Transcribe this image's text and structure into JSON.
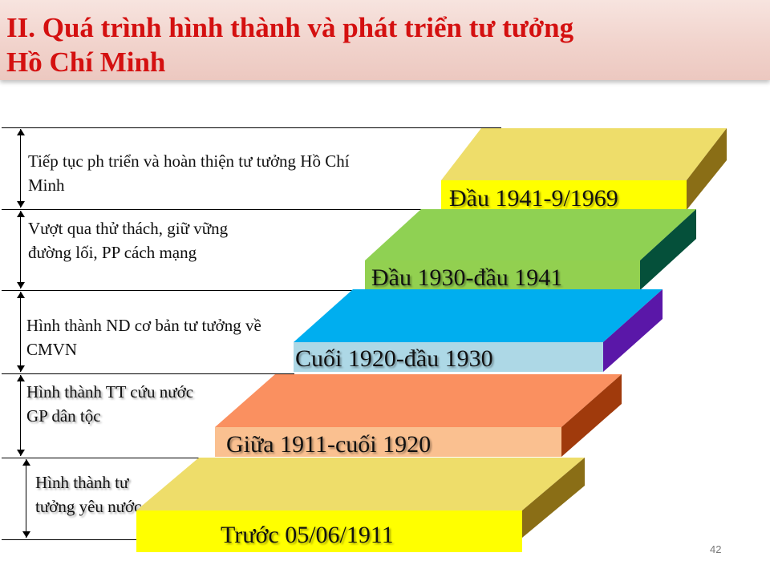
{
  "title": {
    "line1": "II. Quá trình hình thành và phát triển tư tưởng",
    "line2": "Hồ Chí Minh"
  },
  "stages": [
    {
      "period": "Đầu 1941-9/1969",
      "description": "Tiếp tục ph triển và hoàn thiện tư tưởng Hồ Chí Minh"
    },
    {
      "period": "Đầu 1930-đầu 1941",
      "description": "Vượt qua thử thách, giữ vững đường lối, PP cách mạng"
    },
    {
      "period": "Cuối 1920-đầu 1930",
      "description": "Hình thành ND cơ bản tư tưởng về CMVN"
    },
    {
      "period": "Giữa 1911-cuối 1920",
      "description": "Hình thành TT cứu nước GP dân tộc"
    },
    {
      "period": "Trước 05/06/1911",
      "description": "Hình thành tư tưởng yêu nước"
    }
  ],
  "colors": {
    "title": "#d41010",
    "step_yellow_top": "#eedd6a",
    "step_yellow_front": "#ffff00",
    "step_yellow_side": "#8a6e16",
    "step_green_top": "#8fd153",
    "step_green_front": "#92d050",
    "step_green_side": "#05503a",
    "step_blue_top": "#00aeef",
    "step_blue_front": "#add8e6",
    "step_blue_side": "#5a17a8",
    "step_orange_top": "#fa9060",
    "step_orange_front": "#fac090",
    "step_orange_side": "#a03a0c"
  },
  "page_number": "42"
}
